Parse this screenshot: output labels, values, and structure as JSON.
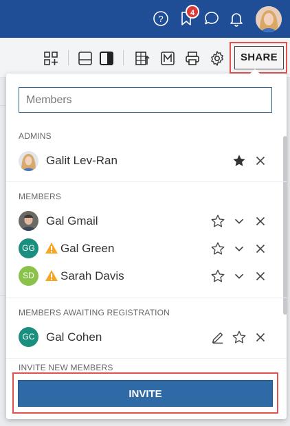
{
  "topbar": {
    "notification_count": "4",
    "icons": [
      "help-icon",
      "bookmark-icon",
      "chat-icon",
      "bell-icon",
      "user-avatar"
    ]
  },
  "toolbar": {
    "icons": [
      "add-widget-icon",
      "layout-row-icon",
      "layout-column-icon",
      "export-icon",
      "m-icon",
      "print-icon",
      "gear-icon"
    ],
    "share_label": "SHARE"
  },
  "panel": {
    "search_placeholder": "Members",
    "admins_heading": "ADMINS",
    "admins": [
      {
        "name": "Galit Lev-Ran",
        "avatar": "photo"
      }
    ],
    "members_heading": "MEMBERS",
    "members": [
      {
        "name": "Gal Gmail",
        "avatar": "photo",
        "warning": false
      },
      {
        "name": "Gal Green",
        "initials": "GG",
        "avatar_color": "#1b8f7f",
        "warning": true
      },
      {
        "name": "Sarah Davis",
        "initials": "SD",
        "avatar_color": "#8bc34a",
        "warning": true
      }
    ],
    "awaiting_heading": "MEMBERS AWAITING REGISTRATION",
    "awaiting": [
      {
        "name": "Gal Cohen",
        "initials": "GC",
        "avatar_color": "#1b8f7f"
      }
    ],
    "invite_heading": "INVITE NEW MEMBERS",
    "invite_label": "INVITE"
  },
  "colors": {
    "topbar": "#1f4e96",
    "highlight": "#e2504f",
    "invite_button": "#2f6aa6",
    "warning": "#f5a623"
  }
}
